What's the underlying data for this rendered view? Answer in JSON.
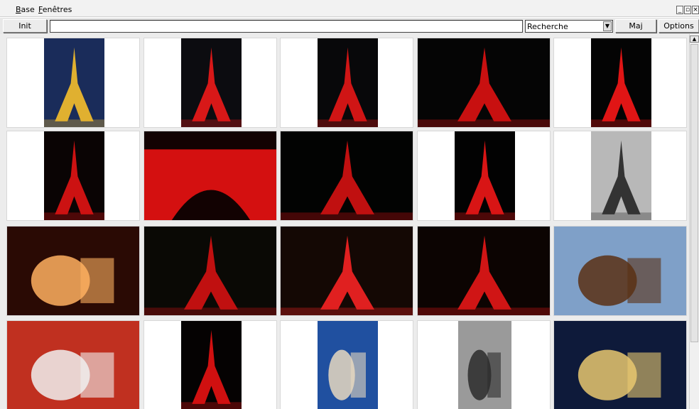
{
  "menu": {
    "items": [
      "Base",
      "Fenêtres"
    ]
  },
  "window_controls": [
    "_",
    "▫",
    "×"
  ],
  "toolbar": {
    "init_label": "Init",
    "search_value": "",
    "combo_value": "Recherche",
    "maj_label": "Maj",
    "options_label": "Options"
  },
  "thumbnails": [
    {
      "name": "eiffel-golden-dusk",
      "bg": "#1a2c5a",
      "fg": "#e0b030",
      "w": 0.45,
      "kind": "tower"
    },
    {
      "name": "eiffel-red-lights-trails",
      "bg": "#0c0c10",
      "fg": "#d81818",
      "w": 0.45,
      "kind": "tower"
    },
    {
      "name": "eiffel-red-river",
      "bg": "#08080a",
      "fg": "#d01515",
      "w": 0.45,
      "kind": "tower"
    },
    {
      "name": "eiffel-red-panorama",
      "bg": "#050505",
      "fg": "#c81010",
      "w": 1.0,
      "kind": "tower"
    },
    {
      "name": "eiffel-red-night",
      "bg": "#040404",
      "fg": "#e01515",
      "w": 0.45,
      "kind": "tower"
    },
    {
      "name": "eiffel-red-closeup",
      "bg": "#0a0404",
      "fg": "#cc1212",
      "w": 0.45,
      "kind": "tower"
    },
    {
      "name": "eiffel-red-arch",
      "bg": "#120202",
      "fg": "#d41010",
      "w": 1.0,
      "kind": "arch"
    },
    {
      "name": "eiffel-red-trees",
      "bg": "#020302",
      "fg": "#c01010",
      "w": 1.0,
      "kind": "tower"
    },
    {
      "name": "eiffel-red-tall",
      "bg": "#020202",
      "fg": "#d81515",
      "w": 0.45,
      "kind": "tower"
    },
    {
      "name": "eiffel-bw-below",
      "bg": "#b8b8b8",
      "fg": "#333333",
      "w": 0.45,
      "kind": "tower"
    },
    {
      "name": "car-parade",
      "bg": "#2a0a04",
      "fg": "#ffb060",
      "w": 1.0,
      "kind": "scene"
    },
    {
      "name": "eiffel-red-street",
      "bg": "#0a0905",
      "fg": "#c01010",
      "w": 1.0,
      "kind": "tower"
    },
    {
      "name": "eiffel-red-bridge",
      "bg": "#140804",
      "fg": "#e02020",
      "w": 1.0,
      "kind": "tower"
    },
    {
      "name": "eiffel-red-cityscape",
      "bg": "#0c0402",
      "fg": "#d01515",
      "w": 1.0,
      "kind": "tower"
    },
    {
      "name": "police-horses-eiffel",
      "bg": "#7fa0c8",
      "fg": "#5a3014",
      "w": 1.0,
      "kind": "scene"
    },
    {
      "name": "jockey-ceremony",
      "bg": "#c03020",
      "fg": "#f0f0f0",
      "w": 1.0,
      "kind": "scene"
    },
    {
      "name": "eiffel-red-closeup-dark",
      "bg": "#050202",
      "fg": "#d01010",
      "w": 0.45,
      "kind": "tower"
    },
    {
      "name": "cow-field",
      "bg": "#2050a0",
      "fg": "#e8d8c0",
      "w": 0.45,
      "kind": "scene"
    },
    {
      "name": "bw-parade-flags",
      "bg": "#9a9a9a",
      "fg": "#2c2c2c",
      "w": 0.4,
      "kind": "scene"
    },
    {
      "name": "press-conference",
      "bg": "#0e1a3a",
      "fg": "#e8c870",
      "w": 1.0,
      "kind": "scene"
    }
  ]
}
